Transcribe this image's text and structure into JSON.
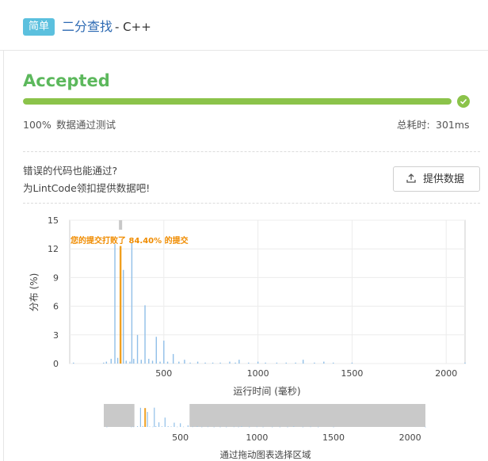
{
  "header": {
    "difficulty": "简单",
    "problem_title": "二分查找",
    "language": "- C++"
  },
  "result": {
    "status": "Accepted",
    "progress_percent": 100,
    "percent_text": "100%",
    "percent_label": "数据通过测试",
    "runtime_label": "总耗时:",
    "runtime_value": "301ms"
  },
  "wrong_code": {
    "question": "错误的代码也能通过?",
    "subtitle": "为LintCode领扣提供数据吧!",
    "button_label": "提供数据"
  },
  "colors": {
    "accepted": "#5cb85c",
    "progress": "#8bc34a",
    "badge": "#5bc0de",
    "title_link": "#2d6ab3",
    "bars": "#90bfe8",
    "highlight": "#f0a020",
    "annotation": "#f08c00"
  },
  "icons": {
    "check": "check-circle-icon",
    "upload": "upload-icon"
  },
  "chart_data": {
    "type": "bar",
    "xlabel": "运行时间 (毫秒)",
    "ylabel": "分布 (%)",
    "xlim": [
      0,
      2100
    ],
    "ylim": [
      0,
      15
    ],
    "xticks": [
      500,
      1000,
      1500,
      2000
    ],
    "yticks": [
      0,
      3,
      6,
      9,
      12,
      15
    ],
    "annotation": "您的提交打败了 84.40% 的提交",
    "highlight_x": 270,
    "highlight_y": 12.3,
    "x": [
      20,
      180,
      195,
      220,
      240,
      255,
      270,
      285,
      300,
      320,
      330,
      340,
      360,
      380,
      400,
      420,
      440,
      460,
      480,
      500,
      520,
      550,
      580,
      610,
      640,
      680,
      720,
      760,
      800,
      850,
      880,
      900,
      950,
      1000,
      1040,
      1100,
      1150,
      1200,
      1240,
      1300,
      1350,
      1400,
      1500,
      2100
    ],
    "values": [
      0.1,
      0.1,
      0.2,
      0.5,
      12.5,
      0.6,
      12.3,
      9.8,
      0.3,
      0.2,
      12.6,
      0.5,
      3.0,
      0.4,
      6.1,
      0.5,
      0.3,
      2.8,
      0.2,
      2.4,
      0.2,
      1.0,
      0.2,
      0.4,
      0.1,
      0.2,
      0.1,
      0.1,
      0.1,
      0.2,
      0.1,
      0.4,
      0.1,
      0.2,
      0.1,
      0.1,
      0.1,
      0.1,
      0.4,
      0.1,
      0.2,
      0.1,
      0.1,
      0.1
    ],
    "navigator": {
      "label": "通过拖动图表选择区域",
      "xticks": [
        500,
        1000,
        1500,
        2000
      ]
    }
  }
}
